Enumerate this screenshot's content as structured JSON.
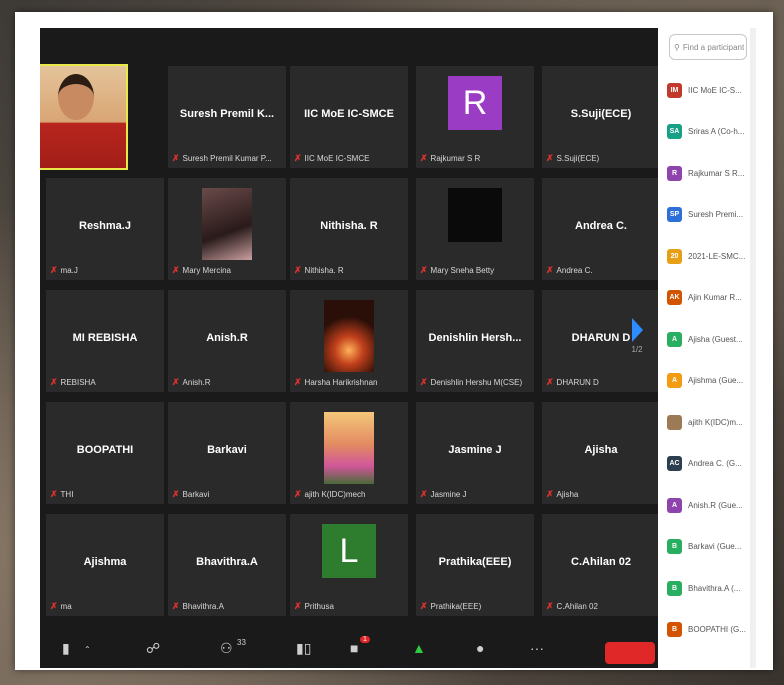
{
  "tiles": [
    {
      "center": "",
      "footer": "",
      "self_video": true
    },
    {
      "center": "Suresh Premil K...",
      "footer": "Suresh Premil Kumar P..."
    },
    {
      "center": "IIC MoE IC-SMCE",
      "footer": "IIC MoE IC-SMCE"
    },
    {
      "center": "",
      "footer": "Rajkumar S R",
      "avatar_letter": "R",
      "avatar_color": "#9b3cc4"
    },
    {
      "center": "S.Suji(ECE)",
      "footer": "S.Suji(ECE)"
    },
    {
      "center": "Reshma.J",
      "footer": "ma.J"
    },
    {
      "center": "",
      "footer": "Mary Mercina",
      "photo": "dark-portrait"
    },
    {
      "center": "Nithisha. R",
      "footer": "Nithisha. R"
    },
    {
      "center": "",
      "footer": "Mary Sneha Betty",
      "black_square": true
    },
    {
      "center": "Andrea C.",
      "footer": "Andrea C."
    },
    {
      "center": "MI REBISHA",
      "footer": "REBISHA"
    },
    {
      "center": "Anish.R",
      "footer": "Anish.R"
    },
    {
      "center": "",
      "footer": "Harsha Harikrishnan",
      "photo": "candle"
    },
    {
      "center": "Denishlin  Hersh...",
      "footer": "Denishlin Hershu M(CSE)"
    },
    {
      "center": "DHARUN D",
      "footer": "DHARUN D"
    },
    {
      "center": "BOOPATHI",
      "footer": "THI"
    },
    {
      "center": "Barkavi",
      "footer": "Barkavi"
    },
    {
      "center": "",
      "footer": "ajith K(IDC)mech",
      "photo": "lotus"
    },
    {
      "center": "Jasmine J",
      "footer": "Jasmine J"
    },
    {
      "center": "Ajisha",
      "footer": "Ajisha"
    },
    {
      "center": "Ajishma",
      "footer": "ma"
    },
    {
      "center": "Bhavithra.A",
      "footer": "Bhavithra.A"
    },
    {
      "center": "",
      "footer": "Prithusa",
      "avatar_letter": "L",
      "avatar_color": "#2e7d2e"
    },
    {
      "center": "Prathika(EEE)",
      "footer": "Prathika(EEE)"
    },
    {
      "center": "C.Ahilan 02",
      "footer": "C.Ahilan 02"
    }
  ],
  "pager": {
    "label": "1/2"
  },
  "toolbar": {
    "participants_count": "33",
    "chat_badge": "1"
  },
  "panel": {
    "search_placeholder": "Find a participant",
    "participants": [
      {
        "initials": "IM",
        "name": "IIC MoE IC-S...",
        "color": "#c0392b"
      },
      {
        "initials": "SA",
        "name": "Sriras A (Co-h...",
        "color": "#16a085"
      },
      {
        "initials": "R",
        "name": "Rajkumar S R...",
        "color": "#8e44ad"
      },
      {
        "initials": "SP",
        "name": "Suresh Premi...",
        "color": "#2d6fd6"
      },
      {
        "initials": "20",
        "name": "2021-LE-SMC...",
        "color": "#e6a018"
      },
      {
        "initials": "AK",
        "name": "Ajin Kumar R...",
        "color": "#d35400"
      },
      {
        "initials": "A",
        "name": "Ajisha (Guest...",
        "color": "#27ae60"
      },
      {
        "initials": "A",
        "name": "Ajishma (Gue...",
        "color": "#f39c12"
      },
      {
        "initials": "",
        "name": "ajith K(IDC)m...",
        "color": "#9c7a56",
        "photo": true
      },
      {
        "initials": "AC",
        "name": "Andrea C. (G...",
        "color": "#2c3e50"
      },
      {
        "initials": "A",
        "name": "Anish.R (Gue...",
        "color": "#8e44ad"
      },
      {
        "initials": "B",
        "name": "Barkavi (Gue...",
        "color": "#27ae60"
      },
      {
        "initials": "B",
        "name": "Bhavithra.A (...",
        "color": "#27ae60"
      },
      {
        "initials": "B",
        "name": "BOOPATHI (G...",
        "color": "#d35400"
      }
    ]
  }
}
